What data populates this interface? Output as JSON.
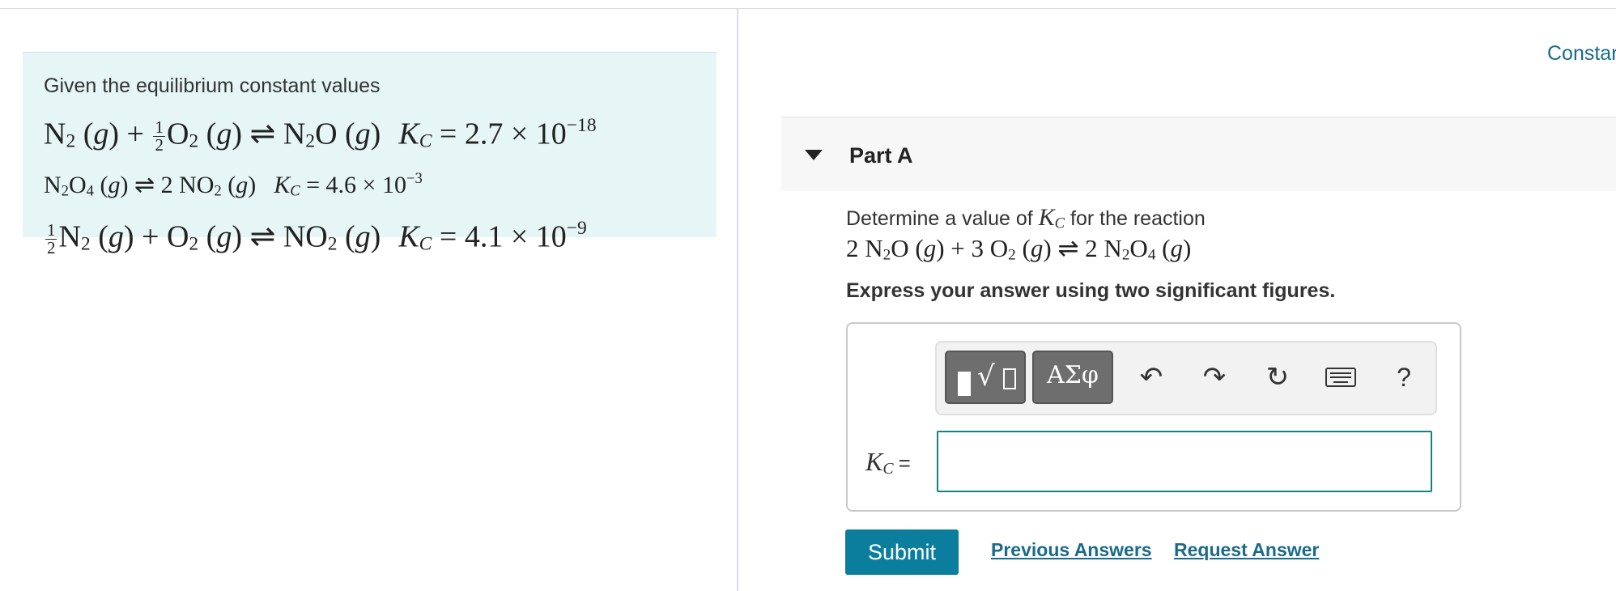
{
  "info": {
    "intro": "Given the equilibrium constant values",
    "eq1": {
      "lhs_a": "N",
      "lhs_a_sub": "2",
      "phase_g": "g",
      "frac_num": "1",
      "frac_den": "2",
      "lhs_b": "O",
      "lhs_b_sub": "2",
      "rhs": "N",
      "rhs_sub": "2",
      "rhs_tail": "O",
      "k": "K",
      "k_sub": "C",
      "k_value": "= 2.7 × 10",
      "k_exp": "−18"
    },
    "eq2": {
      "lhs": "N",
      "lhs_sub1": "2",
      "lhs_mid": "O",
      "lhs_sub2": "4",
      "rhs_coef": "2 NO",
      "rhs_sub": "2",
      "k": "K",
      "k_sub": "C",
      "k_value": "= 4.6 × 10",
      "k_exp": "−3"
    },
    "eq3": {
      "frac_num": "1",
      "frac_den": "2",
      "lhs_a": "N",
      "lhs_a_sub": "2",
      "lhs_b": "O",
      "lhs_b_sub": "2",
      "rhs": "NO",
      "rhs_sub": "2",
      "k": "K",
      "k_sub": "C",
      "k_value": "= 4.1 × 10",
      "k_exp": "−9"
    }
  },
  "header": {
    "constants_link": "Constar"
  },
  "part": {
    "title": "Part A"
  },
  "question": {
    "prefix": "Determine a value of",
    "k": "K",
    "k_sub": "C",
    "suffix": "for the reaction",
    "reaction": {
      "coef1": "2 N",
      "sub1": "2",
      "t1": "O",
      "coef2": "3 O",
      "sub2": "2",
      "coef3": "2 N",
      "sub3": "2",
      "t3": "O",
      "sub4": "4"
    }
  },
  "instruction": "Express your answer using two significant figures.",
  "toolbar": {
    "greek_label": "ΑΣφ",
    "help_label": "?",
    "icons": [
      "templates-icon",
      "greek-letters-icon",
      "undo-icon",
      "redo-icon",
      "reset-icon",
      "keyboard-icon",
      "help-icon"
    ]
  },
  "answer": {
    "label_k": "K",
    "label_sub": "C",
    "label_eq": "=",
    "value": ""
  },
  "actions": {
    "submit": "Submit",
    "previous_answers": "Previous Answers",
    "request_answer": "Request Answer"
  },
  "colors": {
    "accent": "#0b7e9e",
    "link": "#1a6a8a",
    "panel_bg": "#e6f5f6",
    "input_border": "#138184"
  }
}
